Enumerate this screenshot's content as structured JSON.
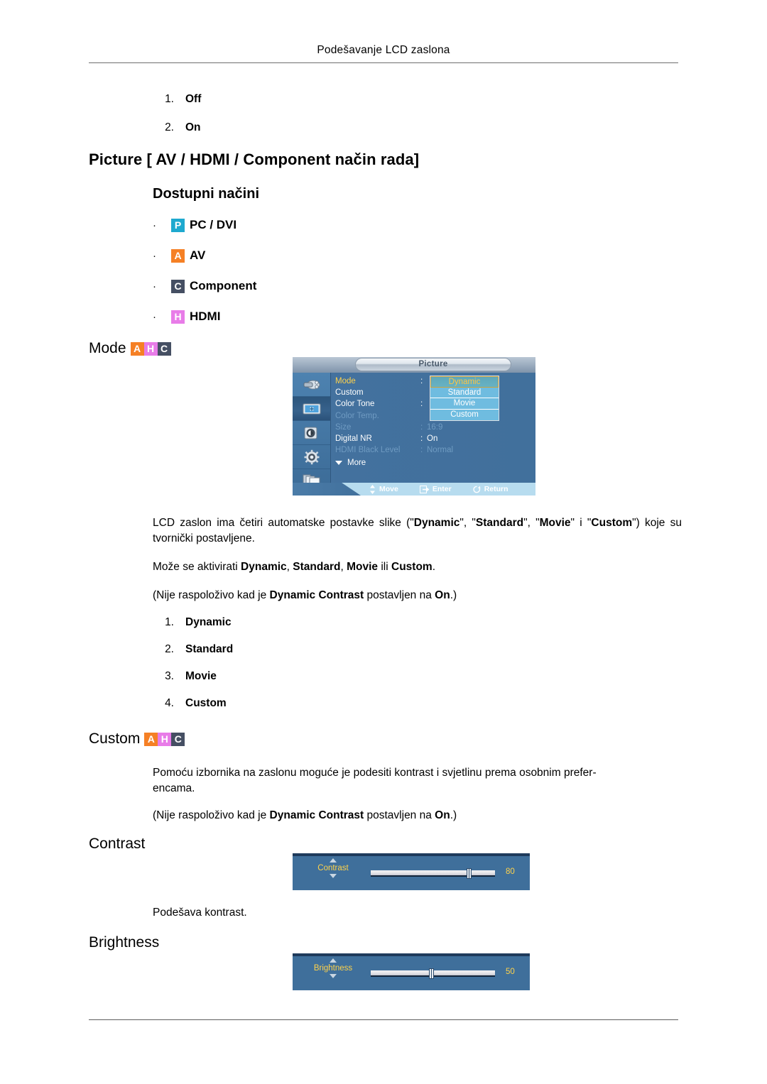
{
  "page": {
    "running_head": "Podešavanje LCD zaslona"
  },
  "intro_list": [
    {
      "idx": "1.",
      "label": "Off"
    },
    {
      "idx": "2.",
      "label": "On"
    }
  ],
  "headings": {
    "picture": "Picture [ AV / HDMI / Component način rada]",
    "available_modes": "Dostupni načini",
    "mode": "Mode",
    "custom": "Custom",
    "contrast": "Contrast",
    "brightness": "Brightness"
  },
  "available_modes": [
    {
      "badge": "P",
      "badge_name": "badge-pc-dvi",
      "label": "PC / DVI",
      "color": "#1ea9cf"
    },
    {
      "badge": "A",
      "badge_name": "badge-av",
      "label": "AV",
      "color": "#f58025"
    },
    {
      "badge": "C",
      "badge_name": "badge-component",
      "label": "Component",
      "color": "#454f63"
    },
    {
      "badge": "H",
      "badge_name": "badge-hdmi",
      "label": "HDMI",
      "color": "#e87ce8"
    }
  ],
  "mode_badges": [
    "A",
    "H",
    "C"
  ],
  "custom_badges": [
    "A",
    "H",
    "C"
  ],
  "paragraphs": {
    "mode_intro_pre": "LCD zaslon ima četiri automatske postavke slike (",
    "mode_intro_full": "LCD zaslon ima četiri automatske postavke slike (\"Dynamic\", \"Standard\", \"Movie\" i \"Custom\") koje su tvornički postavljene.",
    "mode_activate": "Može se aktivirati Dynamic, Standard, Movie ili Custom.",
    "mode_note": "(Nije raspoloživo kad je Dynamic Contrast postavljen na On.)",
    "custom_desc": "Pomoću izbornika na zaslonu moguće je podesiti kontrast i svjetlinu prema osobnim preferencama.",
    "custom_note": "(Nije raspoloživo kad je Dynamic Contrast postavljen na On.)",
    "contrast_desc": "Podešava kontrast."
  },
  "mode_list": [
    {
      "idx": "1.",
      "label": "Dynamic"
    },
    {
      "idx": "2.",
      "label": "Standard"
    },
    {
      "idx": "3.",
      "label": "Movie"
    },
    {
      "idx": "4.",
      "label": "Custom"
    }
  ],
  "osd": {
    "title": "Picture",
    "sidebar_icons": [
      {
        "name": "input-source-icon",
        "selected": false
      },
      {
        "name": "picture-icon",
        "selected": true
      },
      {
        "name": "sound-speaker-icon",
        "selected": false
      },
      {
        "name": "setup-gear-icon",
        "selected": false
      },
      {
        "name": "multi-control-icon",
        "selected": false
      }
    ],
    "rows": [
      {
        "label": "Mode",
        "colon": ":",
        "value": "",
        "state": "highlight"
      },
      {
        "label": "Custom",
        "colon": "",
        "value": "",
        "state": "normal"
      },
      {
        "label": "Color Tone",
        "colon": ":",
        "value": "",
        "state": "normal"
      },
      {
        "label": "Color Temp.",
        "colon": "",
        "value": "",
        "state": "dim"
      },
      {
        "label": "Size",
        "colon": ":",
        "value": "16:9",
        "state": "dim"
      },
      {
        "label": "Digital NR",
        "colon": ":",
        "value": "On",
        "state": "normal"
      },
      {
        "label": "HDMI Black Level",
        "colon": ":",
        "value": "Normal",
        "state": "dim"
      }
    ],
    "more_label": "More",
    "dropdown": {
      "items": [
        "Dynamic",
        "Standard",
        "Movie",
        "Custom"
      ],
      "selected": "Dynamic"
    },
    "footer": [
      {
        "icon": "move-updown-icon",
        "label": "Move"
      },
      {
        "icon": "enter-icon",
        "label": "Enter"
      },
      {
        "icon": "return-icon",
        "label": "Return"
      }
    ]
  },
  "sliders": [
    {
      "name": "Contrast",
      "value": "80",
      "percent": 80
    },
    {
      "name": "Brightness",
      "value": "50",
      "percent": 50
    }
  ]
}
